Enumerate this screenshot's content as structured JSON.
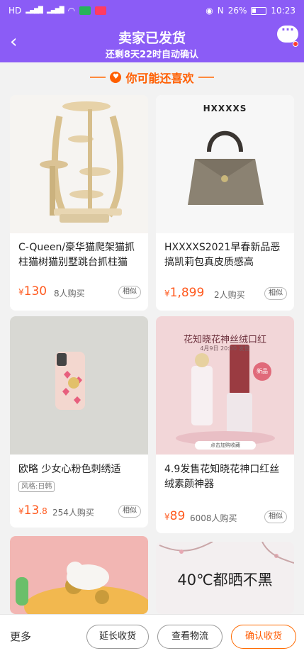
{
  "status": {
    "network": "HD",
    "battery_pct": "26%",
    "time": "10:23"
  },
  "header": {
    "title": "卖家已发货",
    "subtitle": "还剩8天22时自动确认"
  },
  "section": {
    "title": "你可能还喜欢"
  },
  "products": [
    {
      "name": "C-Queen/豪华猫爬架猫抓柱猫树猫别墅跳台抓柱猫",
      "price_symbol": "¥",
      "price_int": "130",
      "price_dec": "",
      "buyers": "8人购买",
      "similar": "相似"
    },
    {
      "name": "HXXXXS2021早春新品恶搞凯莉包真皮质感高",
      "price_symbol": "¥",
      "price_int": "1,899",
      "price_dec": "",
      "buyers": "2人购买",
      "similar": "相似",
      "img_text": "HXXXXS"
    },
    {
      "name": "欧略 少女心粉色刺绣适",
      "tag": "风格:日韩",
      "price_symbol": "¥",
      "price_int": "13",
      "price_dec": ".8",
      "buyers": "254人购买",
      "similar": "相似"
    },
    {
      "name": "4.9发售花知晓花神口红丝绒素颜神器",
      "price_symbol": "¥",
      "price_int": "89",
      "price_dec": "",
      "buyers": "6008人购买",
      "similar": "相似",
      "img_text": "花知晓花神丝绒口红",
      "img_sub": "4月9日 20:00 发售",
      "img_badge": "新品",
      "img_cta": "点击加购收藏"
    },
    {
      "img_text": ""
    },
    {
      "img_text": "40℃都晒不黑"
    }
  ],
  "bottom": {
    "more": "更多",
    "extend": "延长收货",
    "logistics": "查看物流",
    "confirm": "确认收货"
  },
  "colors": {
    "brand": "#8b5cf6",
    "accent": "#ff5a1f"
  }
}
